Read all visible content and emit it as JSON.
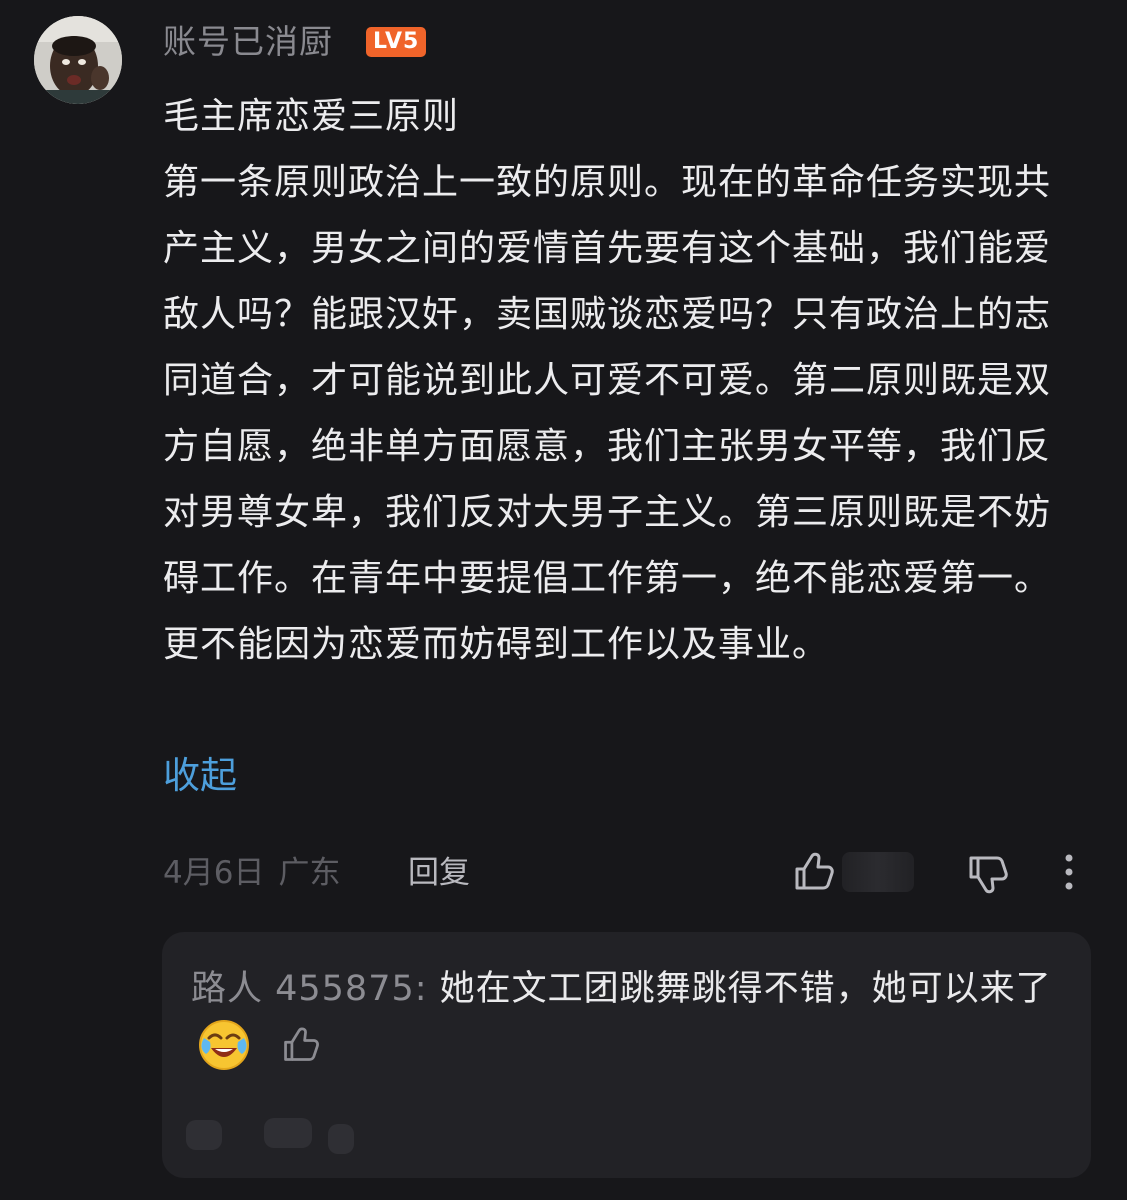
{
  "comment": {
    "username": "账号已消厨",
    "level": "LV5",
    "title": "毛主席恋爱三原则",
    "body": "第一条原则政治上一致的原则。现在的革命任务实现共产主义，男女之间的爱情首先要有这个基础，我们能爱敌人吗？能跟汉奸，卖国贼谈恋爱吗？只有政治上的志同道合，才可能说到此人可爱不可爱。第二原则既是双方自愿，绝非单方面愿意，我们主张男女平等，我们反对男尊女卑，我们反对大男子主义。第三原则既是不妨碍工作。在青年中要提倡工作第一，绝不能恋爱第一。更不能因为恋爱而妨碍到工作以及事业。",
    "collapse_label": "收起",
    "date": "4月6日",
    "location": "广东",
    "reply_label": "回复"
  },
  "reply": {
    "author": "路人 455875:",
    "text": " 她在文工团跳舞跳得不错，她可以来了",
    "emoji": "laughing-crying-emoji"
  },
  "icons": {
    "like": "thumbs-up-icon",
    "dislike": "thumbs-down-icon",
    "more": "more-vertical-icon"
  },
  "colors": {
    "background": "#17171a",
    "link": "#4d9fdc",
    "level_badge": "#f0642a",
    "reply_box": "#222226"
  }
}
